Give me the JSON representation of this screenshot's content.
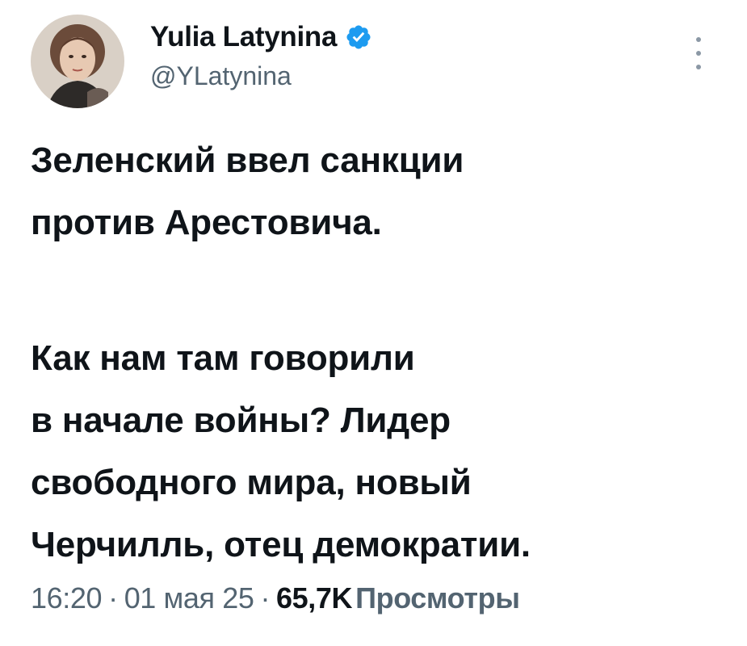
{
  "author": {
    "display_name": "Yulia Latynina",
    "handle": "@YLatynina",
    "verified": true,
    "avatar_icon": "profile-photo"
  },
  "menu_icon": "more-options-vertical-icon",
  "tweet": {
    "paragraphs": [
      [
        "Зеленский ввел санкции",
        "против Арестовича."
      ],
      [
        "Как нам там говорили",
        "в начале войны? Лидер",
        "свободного мира, новый",
        "Черчилль, отец демократии."
      ]
    ]
  },
  "meta": {
    "time": "16:20",
    "date": "01 мая 25",
    "separator": "·",
    "views_count": "65,7K",
    "views_label": "Просмотры"
  },
  "colors": {
    "text": "#0f1419",
    "secondary": "#536471",
    "verified_badge": "#1d9bf0"
  }
}
